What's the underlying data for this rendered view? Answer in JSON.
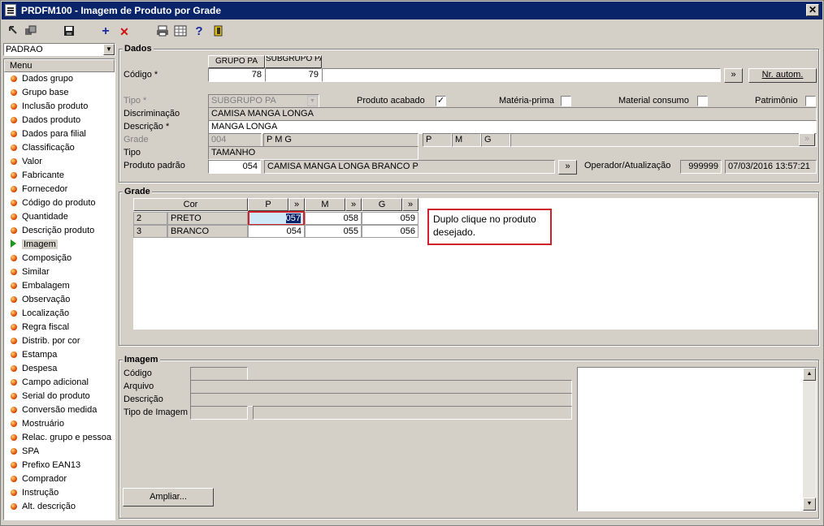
{
  "window": {
    "title": "PRDFM100 - Imagem de Produto por Grade",
    "close_label": "✕"
  },
  "toolbar": {
    "icons": [
      "back-icon",
      "copy-icon",
      "save-icon",
      "add-icon",
      "delete-icon",
      "print-icon",
      "grid-icon",
      "help-icon",
      "exit-icon"
    ],
    "add_glyph": "+",
    "delete_glyph": "✕",
    "help_glyph": "?"
  },
  "sidebar": {
    "combo_value": "PADRAO",
    "menu_header": "Menu",
    "items": [
      {
        "label": "Dados grupo"
      },
      {
        "label": "Grupo base"
      },
      {
        "label": "Inclusão produto"
      },
      {
        "label": "Dados produto"
      },
      {
        "label": "Dados para filial"
      },
      {
        "label": "Classificação"
      },
      {
        "label": "Valor"
      },
      {
        "label": "Fabricante"
      },
      {
        "label": "Fornecedor"
      },
      {
        "label": "Código do produto"
      },
      {
        "label": "Quantidade"
      },
      {
        "label": "Descrição produto"
      },
      {
        "label": "Imagem",
        "active": true
      },
      {
        "label": "Composição"
      },
      {
        "label": "Similar"
      },
      {
        "label": "Embalagem"
      },
      {
        "label": "Observação"
      },
      {
        "label": "Localização"
      },
      {
        "label": "Regra fiscal"
      },
      {
        "label": "Distrib. por cor"
      },
      {
        "label": "Estampa"
      },
      {
        "label": "Despesa"
      },
      {
        "label": "Campo adicional"
      },
      {
        "label": "Serial do produto"
      },
      {
        "label": "Conversão medida"
      },
      {
        "label": "Mostruário"
      },
      {
        "label": "Relac. grupo e pessoa"
      },
      {
        "label": "SPA"
      },
      {
        "label": "Prefixo EAN13"
      },
      {
        "label": "Comprador"
      },
      {
        "label": "Instrução"
      },
      {
        "label": "Alt. descrição"
      }
    ]
  },
  "dados": {
    "caption": "Dados",
    "col_grupo_pa": "GRUPO PA",
    "col_subgrupo_pa": "SUBGRUPO PA",
    "codigo_label": "Código *",
    "grupo_pa_value": "78",
    "subgrupo_pa_value": "79",
    "codigo_extra_value": "",
    "expand_label": "»",
    "nr_autom_label": "Nr. autom.",
    "tipo_label": "Tipo *",
    "tipo_value": "SUBGRUPO PA",
    "produto_acabado_label": "Produto acabado",
    "produto_acabado_checked": "✓",
    "materia_prima_label": "Matéria-prima",
    "material_consumo_label": "Material consumo",
    "patrimonio_label": "Patrimônio",
    "discriminacao_label": "Discriminação",
    "discriminacao_value": "CAMISA MANGA LONGA",
    "descricao_label": "Descrição *",
    "descricao_value": "MANGA LONGA",
    "grade_label": "Grade",
    "grade_code": "004",
    "grade_desc": "P M G",
    "grade_sizes": [
      "P",
      "M",
      "G"
    ],
    "grade_btn": "»",
    "tipo2_label": "Tipo",
    "tipo2_value": "TAMANHO",
    "produto_padrao_label": "Produto padrão",
    "produto_padrao_code": "054",
    "produto_padrao_desc": "CAMISA MANGA LONGA BRANCO P",
    "operador_label": "Operador/Atualização",
    "operador_value": "999999",
    "atualizacao_value": "07/03/2016 13:57:21"
  },
  "grade": {
    "caption": "Grade",
    "headers": {
      "cor": "Cor",
      "p": "P",
      "m": "M",
      "g": "G",
      "expand": "»"
    },
    "rows": [
      {
        "num": "2",
        "cor": "PRETO",
        "p": "057",
        "m": "058",
        "g": "059"
      },
      {
        "num": "3",
        "cor": "BRANCO",
        "p": "054",
        "m": "055",
        "g": "056"
      }
    ],
    "note": "Duplo clique no produto desejado."
  },
  "imagem": {
    "caption": "Imagem",
    "codigo_label": "Código",
    "arquivo_label": "Arquivo",
    "descricao_label": "Descrição",
    "tipo_label": "Tipo de Imagem",
    "ampliar_label": "Ampliar..."
  },
  "colors": {
    "title_bar": "#0a246a",
    "window_bg": "#d4d0c8",
    "note_border": "#d0202a",
    "selected_cell": "#0a246a"
  }
}
